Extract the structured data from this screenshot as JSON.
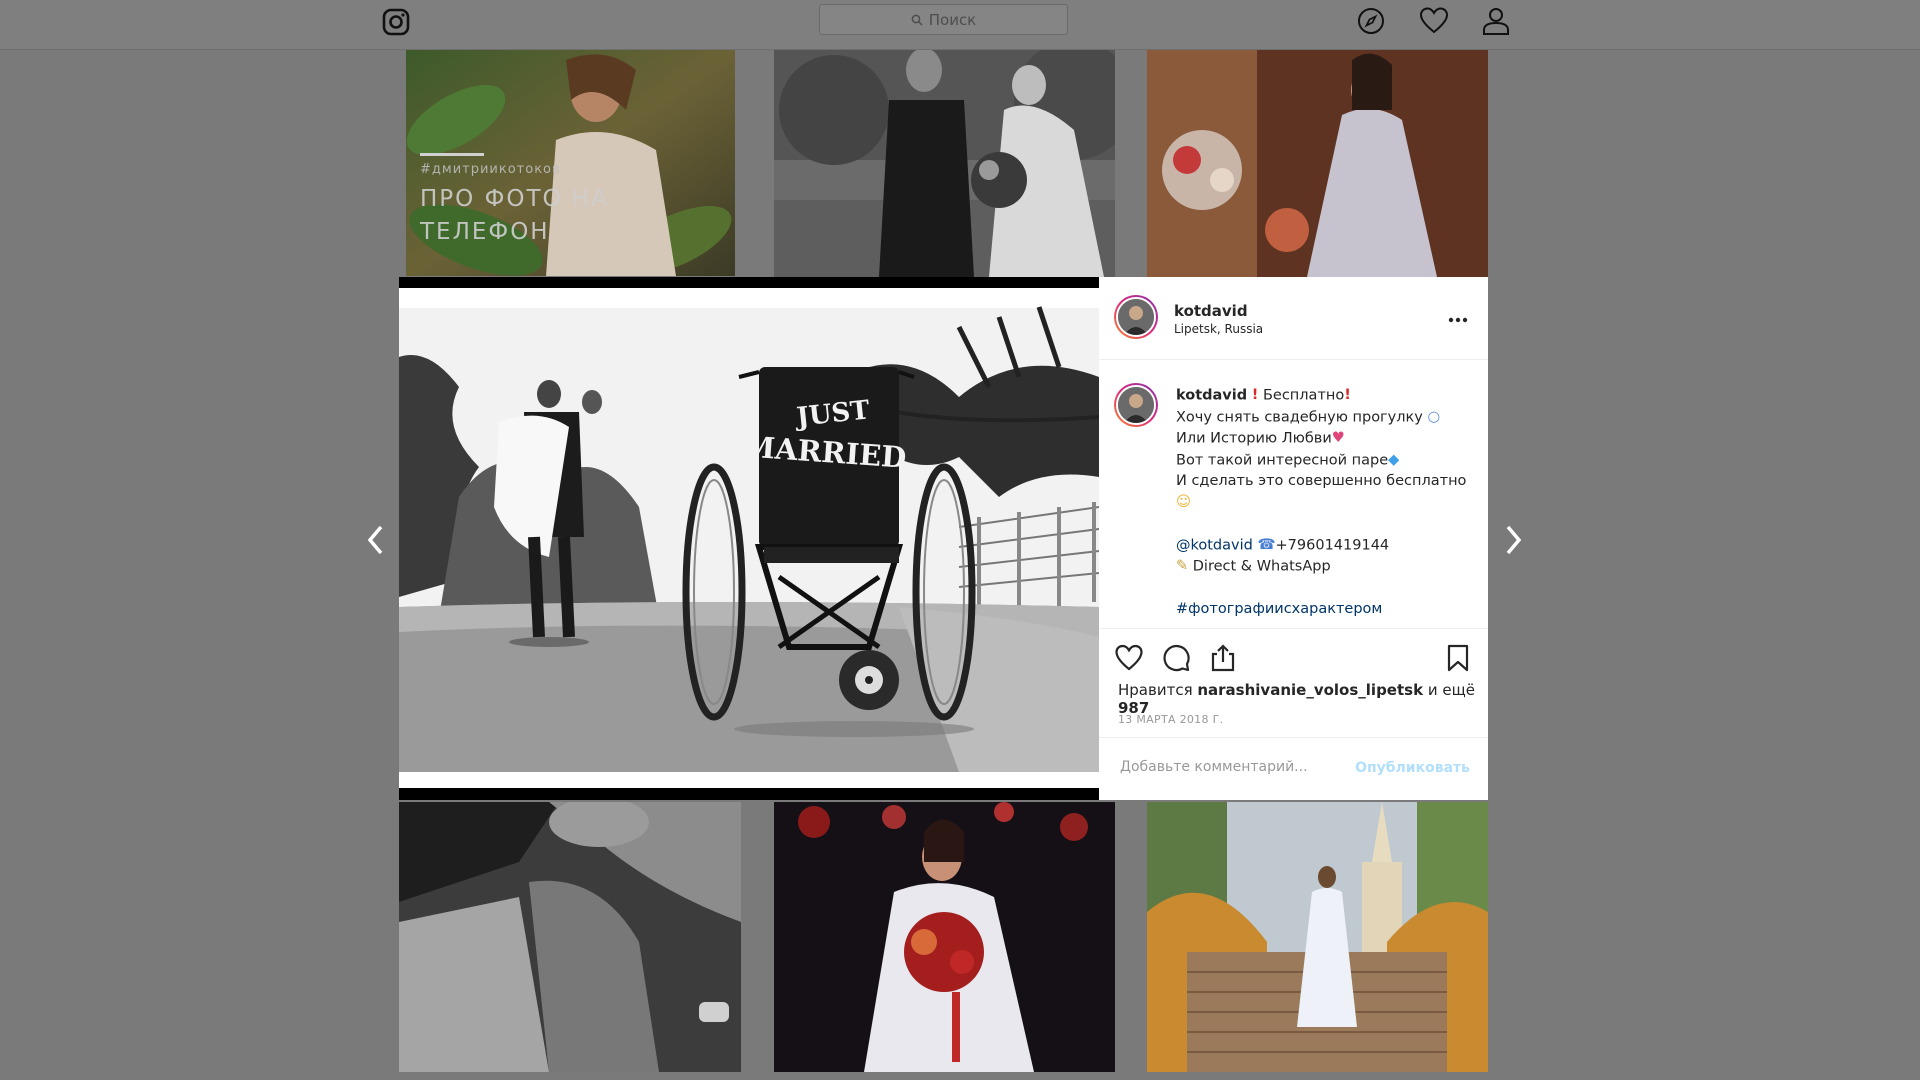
{
  "topbar": {
    "search_placeholder": "Поиск"
  },
  "grid": {
    "tile1_tag": "#дмитриикотоков",
    "tile1_title_line1": "ПРО ФОТО НА",
    "tile1_title_line2": "ТЕЛЕФОН"
  },
  "post": {
    "photo_sign_line1": "JUST",
    "photo_sign_line2": "MARRIED",
    "author": "kotdavid",
    "location": "Lipetsk, Russia",
    "caption": {
      "username": "kotdavid",
      "line1_text": " Бесплатно",
      "line2": "Хочу снять свадебную прогулку",
      "line3": "Или Историю Любви",
      "line4": "Вот такой интересной паре",
      "line5": "И сделать это совершенно бесплатно",
      "mention": "@kotdavid",
      "phone": "+79601419144",
      "contact_text": " Direct & WhatsApp",
      "hashtag": "#фотографиисхарактером"
    },
    "likes_prefix": "Нравится ",
    "likes_user": "narashivanie_volos_lipetsk",
    "likes_suffix": " и ещё ",
    "likes_count": "987",
    "date": "13 МАРТА 2018 Г.",
    "comment_placeholder": "Добавьте комментарий...",
    "publish_label": "Опубликовать"
  },
  "colors": {
    "overlay_bg": "#7a7a7a",
    "link": "#003569",
    "publish_disabled": "#b2dffc",
    "text": "#262626",
    "muted": "#999999"
  },
  "icons": {
    "logo": "instagram-logo-icon",
    "explore": "compass-icon",
    "activity": "heart-icon",
    "profile": "user-icon",
    "prev": "chevron-left-icon",
    "next": "chevron-right-icon",
    "more": "ellipsis-icon",
    "like": "heart-outline-icon",
    "comment": "comment-icon",
    "share": "share-icon",
    "save": "bookmark-icon"
  }
}
